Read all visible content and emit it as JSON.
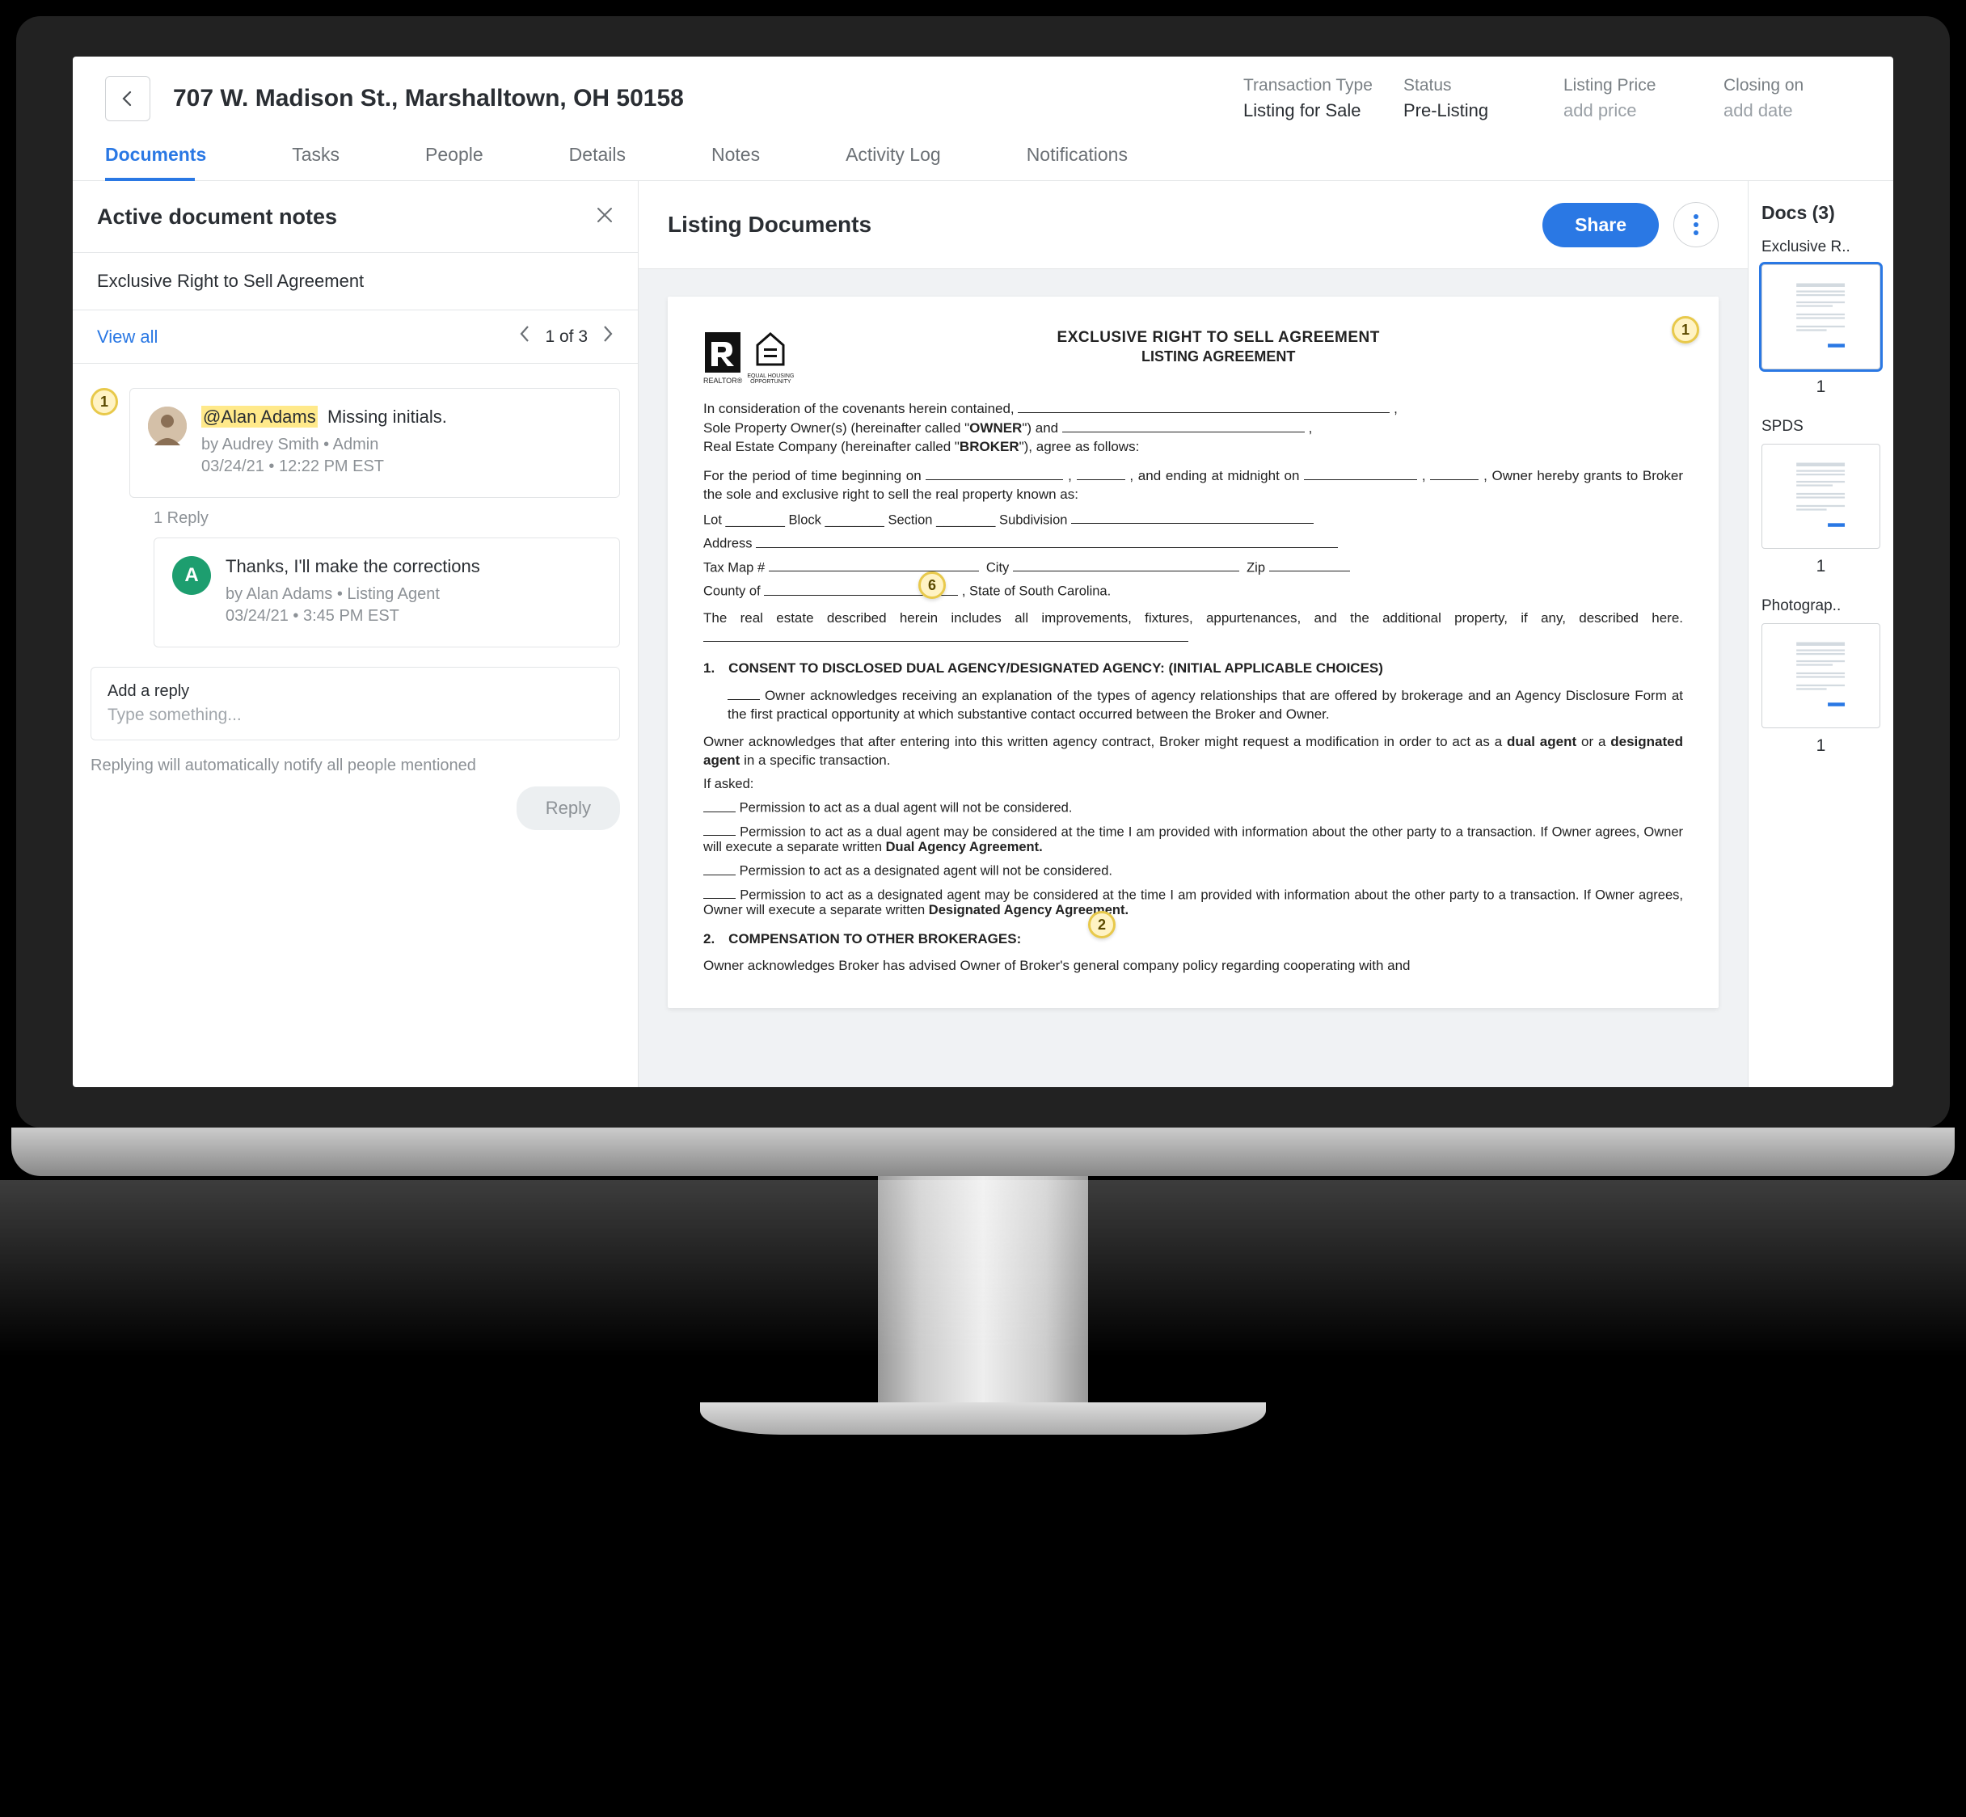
{
  "header": {
    "address": "707 W. Madison St., Marshalltown, OH 50158",
    "meta": [
      {
        "label": "Transaction Type",
        "value": "Listing for Sale",
        "placeholder": false
      },
      {
        "label": "Status",
        "value": "Pre-Listing",
        "placeholder": false
      },
      {
        "label": "Listing Price",
        "value": "add price",
        "placeholder": true
      },
      {
        "label": "Closing on",
        "value": "add date",
        "placeholder": true
      }
    ]
  },
  "tabs": [
    "Documents",
    "Tasks",
    "People",
    "Details",
    "Notes",
    "Activity Log",
    "Notifications"
  ],
  "active_tab": 0,
  "notes_panel": {
    "title": "Active document notes",
    "doc_name": "Exclusive Right to Sell Agreement",
    "view_all": "View all",
    "pagination": "1 of 3",
    "marker_num": "1",
    "note1": {
      "mention": "@Alan Adams",
      "text": "Missing initials.",
      "byline": "by Audrey Smith • Admin",
      "time": "03/24/21 • 12:22 PM EST"
    },
    "reply_count": "1 Reply",
    "reply": {
      "avatar_letter": "A",
      "text": "Thanks, I'll make the corrections",
      "byline": "by Alan Adams • Listing Agent",
      "time": "03/24/21 • 3:45 PM EST"
    },
    "reply_box_label": "Add a reply",
    "reply_placeholder": "Type something...",
    "reply_helper": "Replying will automatically notify all people mentioned",
    "reply_btn": "Reply"
  },
  "center": {
    "title": "Listing Documents",
    "share": "Share",
    "doc": {
      "title1": "EXCLUSIVE RIGHT TO SELL AGREEMENT",
      "title2": "LISTING AGREEMENT",
      "logo_r": "REALTOR®",
      "markers": {
        "top_right": "1",
        "center": "6",
        "bottom": "2"
      },
      "intro1": "In consideration of the covenants herein contained,",
      "intro2": "Sole Property Owner(s) (hereinafter called \"",
      "owner_bold": "OWNER",
      "intro2b": "\") and",
      "intro3": "Real Estate Company (hereinafter called \"",
      "broker_bold": "BROKER",
      "intro3b": "\"), agree as follows:",
      "period_a": "For the period of time beginning on",
      "period_b": ", and ending at midnight on",
      "period_c": ", Owner hereby grants to Broker the sole and exclusive right to sell the real property known as:",
      "row_lot": "Lot ________  Block ________  Section ________  Subdivision",
      "row_addr": "Address",
      "row_tax": "Tax Map #",
      "row_city": "City",
      "row_zip": "Zip",
      "row_county": "County of",
      "row_county_b": ", State of South Carolina.",
      "prop_desc": "The real estate described herein includes all improvements, fixtures, appurtenances, and the additional property, if any, described here.",
      "sec1_h": "1. CONSENT TO DISCLOSED DUAL AGENCY/DESIGNATED AGENCY: (INITIAL APPLICABLE CHOICES)",
      "sec1_p1": "Owner acknowledges receiving an explanation of the types of agency relationships that are offered by brokerage and an Agency Disclosure Form at the first practical opportunity at which substantive contact occurred between the Broker and Owner.",
      "sec1_p2a": "Owner acknowledges that after entering into this written agency contract, Broker might request a modification in order to act as a ",
      "sec1_p2_bold1": "dual agent",
      "sec1_p2b": " or a ",
      "sec1_p2_bold2": "designated agent",
      "sec1_p2c": " in a specific transaction.",
      "asked": "If asked:",
      "bullet1": "Permission to act as a dual agent will not be considered.",
      "bullet2a": "Permission to act as a dual agent may be considered at the time I am provided with information about the other party to a transaction. If Owner agrees, Owner will execute a separate written ",
      "bullet2_bold": "Dual Agency Agreement.",
      "bullet3": "Permission to act as a designated agent will not be considered.",
      "bullet4a": "Permission to act as a designated agent may be considered at the time I am provided with information about the other party to a transaction. If Owner agrees, Owner will execute a separate written ",
      "bullet4_bold": "Designated Agency Agreement.",
      "sec2_h": "2. COMPENSATION TO OTHER BROKERAGES:",
      "sec2_p": "Owner acknowledges Broker has advised Owner of Broker's general company policy regarding cooperating with and"
    }
  },
  "docs": {
    "header": "Docs (3)",
    "items": [
      {
        "label": "Exclusive R..",
        "page": "1",
        "active": true
      },
      {
        "label": "SPDS",
        "page": "1",
        "active": false
      },
      {
        "label": "Photograp..",
        "page": "1",
        "active": false
      }
    ]
  }
}
